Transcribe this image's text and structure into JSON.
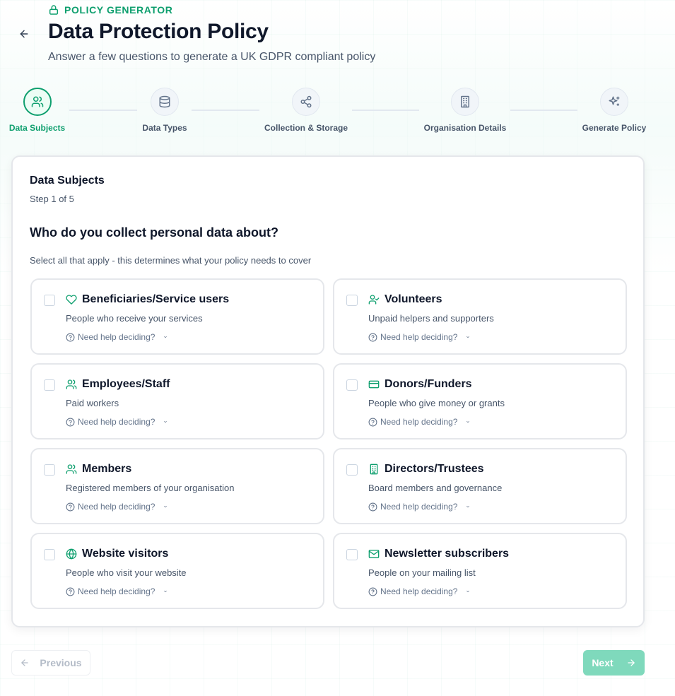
{
  "header": {
    "eyebrow": "POLICY GENERATOR",
    "title": "Data Protection Policy",
    "subtitle": "Answer a few questions to generate a UK GDPR compliant policy"
  },
  "steps": [
    {
      "label": "Data Subjects",
      "icon": "users-icon",
      "active": true
    },
    {
      "label": "Data Types",
      "icon": "database-icon",
      "active": false
    },
    {
      "label": "Collection & Storage",
      "icon": "share-icon",
      "active": false
    },
    {
      "label": "Organisation Details",
      "icon": "building-icon",
      "active": false
    },
    {
      "label": "Generate Policy",
      "icon": "sparkles-icon",
      "active": false
    }
  ],
  "card": {
    "title": "Data Subjects",
    "step": "Step 1 of 5",
    "question": "Who do you collect personal data about?",
    "hint": "Select all that apply - this determines what your policy needs to cover"
  },
  "options": [
    {
      "title": "Beneficiaries/Service users",
      "desc": "People who receive your services",
      "help": "Need help deciding?",
      "icon": "heart-icon"
    },
    {
      "title": "Volunteers",
      "desc": "Unpaid helpers and supporters",
      "help": "Need help deciding?",
      "icon": "user-check-icon"
    },
    {
      "title": "Employees/Staff",
      "desc": "Paid workers",
      "help": "Need help deciding?",
      "icon": "users-icon"
    },
    {
      "title": "Donors/Funders",
      "desc": "People who give money or grants",
      "help": "Need help deciding?",
      "icon": "credit-card-icon"
    },
    {
      "title": "Members",
      "desc": "Registered members of your organisation",
      "help": "Need help deciding?",
      "icon": "users-icon"
    },
    {
      "title": "Directors/Trustees",
      "desc": "Board members and governance",
      "help": "Need help deciding?",
      "icon": "building-icon"
    },
    {
      "title": "Website visitors",
      "desc": "People who visit your website",
      "help": "Need help deciding?",
      "icon": "globe-icon"
    },
    {
      "title": "Newsletter subscribers",
      "desc": "People on your mailing list",
      "help": "Need help deciding?",
      "icon": "mail-icon"
    }
  ],
  "footer": {
    "previous_label": "Previous",
    "next_label": "Next"
  },
  "colors": {
    "accent": "#0e9f6e",
    "next_button": "#7fd9bc"
  }
}
